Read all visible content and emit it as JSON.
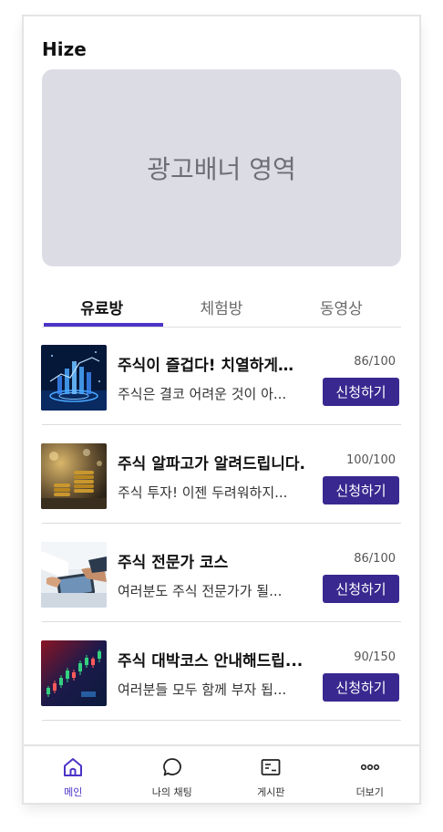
{
  "app": {
    "title": "Hize"
  },
  "banner": {
    "text": "광고배너 영역"
  },
  "tabs": [
    {
      "label": "유료방",
      "active": true
    },
    {
      "label": "체험방",
      "active": false
    },
    {
      "label": "동영상",
      "active": false
    }
  ],
  "rooms": [
    {
      "title": "주식이 즐겁다! 치열하게…",
      "description": "주식은 결코 어려운 것이 아...",
      "count": "86/100",
      "button": "신청하기",
      "thumbnail": "stock-chart-hologram"
    },
    {
      "title": "주식 알파고가 알려드립니다.",
      "description": "주식 투자! 이젠 두려워하지...",
      "count": "100/100",
      "button": "신청하기",
      "thumbnail": "coin-stacks"
    },
    {
      "title": "주식 전문가 코스",
      "description": "여러분도 주식 전문가가 될...",
      "count": "86/100",
      "button": "신청하기",
      "thumbnail": "hands-tablet"
    },
    {
      "title": "주식 대박코스 안내해드립...",
      "description": "여러분들 모두 함께 부자 됩...",
      "count": "90/150",
      "button": "신청하기",
      "thumbnail": "candlestick-chart"
    }
  ],
  "nav": [
    {
      "label": "메인",
      "icon": "home-icon",
      "active": true
    },
    {
      "label": "나의 채팅",
      "icon": "chat-bubble-icon",
      "active": false
    },
    {
      "label": "게시판",
      "icon": "board-icon",
      "active": false
    },
    {
      "label": "더보기",
      "icon": "more-icon",
      "active": false
    }
  ],
  "colors": {
    "accent": "#4b34c7",
    "button": "#39288f",
    "banner": "#dcdce5"
  }
}
